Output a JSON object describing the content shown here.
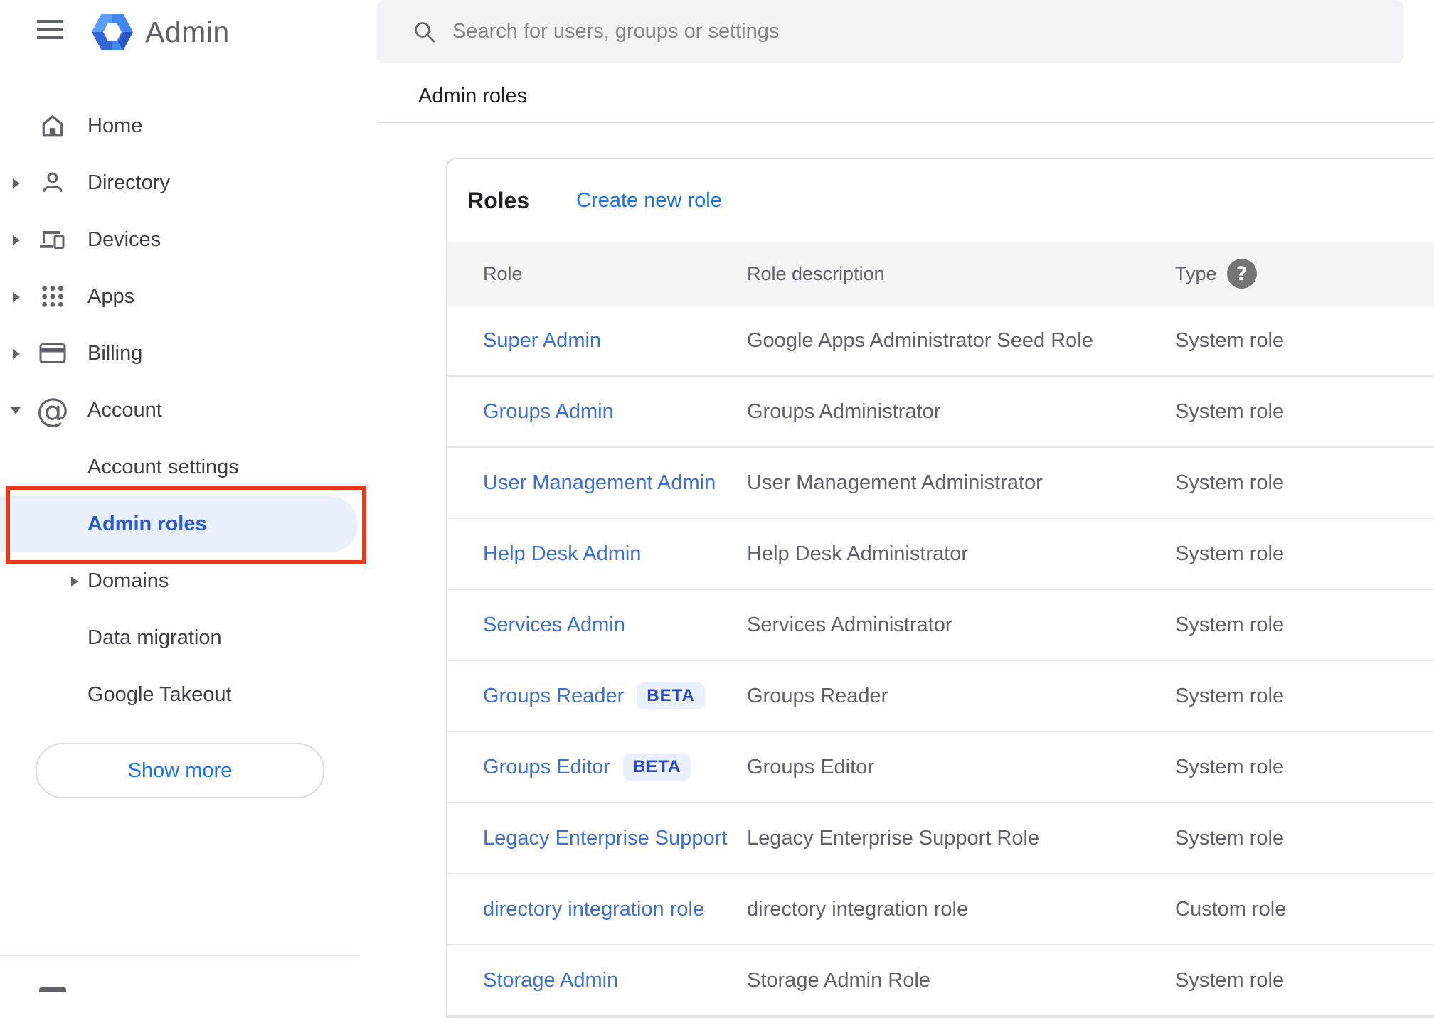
{
  "brand": {
    "product_name": "Admin"
  },
  "search": {
    "placeholder": "Search for users, groups or settings"
  },
  "breadcrumb": "Admin roles",
  "sidebar": {
    "items": [
      {
        "label": "Home"
      },
      {
        "label": "Directory"
      },
      {
        "label": "Devices"
      },
      {
        "label": "Apps"
      },
      {
        "label": "Billing"
      },
      {
        "label": "Account"
      },
      {
        "label": "Account settings"
      },
      {
        "label": "Admin roles"
      },
      {
        "label": "Domains"
      },
      {
        "label": "Data migration"
      },
      {
        "label": "Google Takeout"
      }
    ],
    "selected_item": "Admin roles",
    "show_more_label": "Show more"
  },
  "card": {
    "title": "Roles",
    "create_link": "Create new role",
    "beta_badge_label": "BETA",
    "columns": {
      "role": "Role",
      "description": "Role description",
      "type": "Type"
    },
    "rows": [
      {
        "role": "Super Admin",
        "beta": false,
        "description": "Google Apps Administrator Seed Role",
        "type": "System role"
      },
      {
        "role": "Groups Admin",
        "beta": false,
        "description": "Groups Administrator",
        "type": "System role"
      },
      {
        "role": "User Management Admin",
        "beta": false,
        "description": "User Management Administrator",
        "type": "System role"
      },
      {
        "role": "Help Desk Admin",
        "beta": false,
        "description": "Help Desk Administrator",
        "type": "System role"
      },
      {
        "role": "Services Admin",
        "beta": false,
        "description": "Services Administrator",
        "type": "System role"
      },
      {
        "role": "Groups Reader",
        "beta": true,
        "description": "Groups Reader",
        "type": "System role"
      },
      {
        "role": "Groups Editor",
        "beta": true,
        "description": "Groups Editor",
        "type": "System role"
      },
      {
        "role": "Legacy Enterprise Support",
        "beta": false,
        "description": "Legacy Enterprise Support Role",
        "type": "System role"
      },
      {
        "role": "directory integration role",
        "beta": false,
        "description": "directory integration role",
        "type": "Custom role"
      },
      {
        "role": "Storage Admin",
        "beta": false,
        "description": "Storage Admin Role",
        "type": "System role"
      }
    ]
  },
  "colors": {
    "accent_blue": "#1a73e8",
    "link_blue": "#3e6fd3",
    "selected_pill_bg": "#e8f0fe",
    "annotation_red": "#e8391c",
    "icon_gray": "#5f6368",
    "header_row_bg": "#f5f5f6"
  }
}
